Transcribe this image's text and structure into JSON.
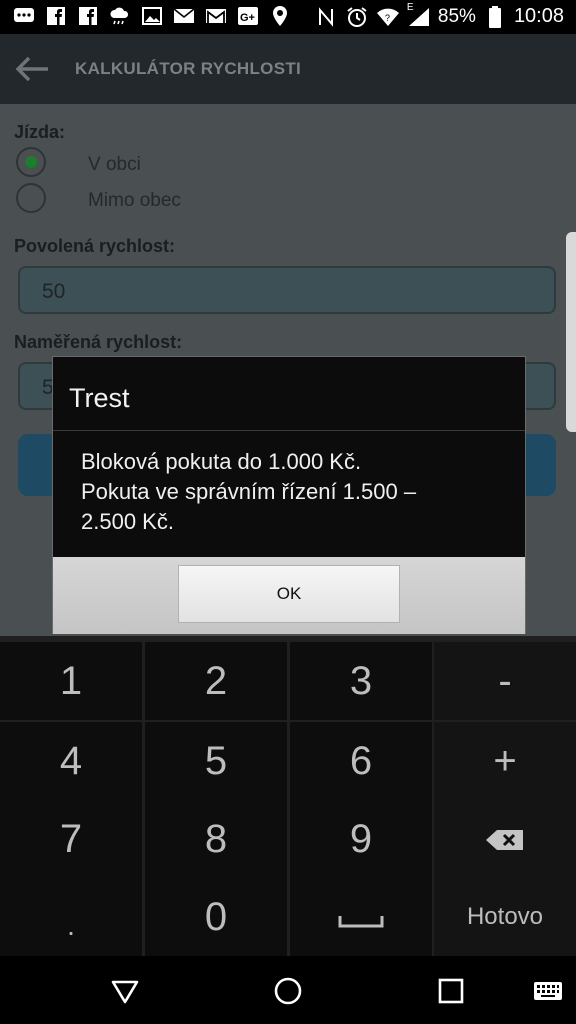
{
  "status_bar": {
    "icons": [
      "chat-icon",
      "facebook-icon",
      "facebook-icon",
      "weather-icon",
      "image-icon",
      "email-icon",
      "gmail-icon",
      "google-plus-icon",
      "location-icon",
      "nfc-icon",
      "alarm-icon",
      "wifi-icon",
      "signal-icon"
    ],
    "network": "E",
    "battery": "85%",
    "time": "10:08"
  },
  "toolbar": {
    "title": "KALKULÁTOR RYCHLOSTI"
  },
  "form": {
    "ride_label": "Jízda:",
    "options": [
      {
        "label": "V obci",
        "selected": true
      },
      {
        "label": "Mimo obec",
        "selected": false
      }
    ],
    "allowed_label": "Povolená rychlost:",
    "allowed_value": "50",
    "measured_label": "Naměřená rychlost:",
    "measured_value": "5"
  },
  "dialog": {
    "title": "Trest",
    "message_line1": "Bloková pokuta do 1.000 Kč.",
    "message_line2": "Pokuta ve správním řízení 1.500 –",
    "message_line3": "2.500 Kč.",
    "ok_label": "OK"
  },
  "keypad": {
    "rows": [
      [
        "1",
        "2",
        "3",
        "-"
      ],
      [
        "4",
        "5",
        "6",
        "+"
      ],
      [
        "7",
        "8",
        "9",
        "backspace-icon"
      ],
      [
        ".",
        "0",
        "space-icon",
        "Hotovo"
      ]
    ]
  },
  "colors": {
    "accent": "#1c7d2b",
    "dialog_bg": "#0c0c0c",
    "keypad_bg": "#0d0d0d"
  }
}
